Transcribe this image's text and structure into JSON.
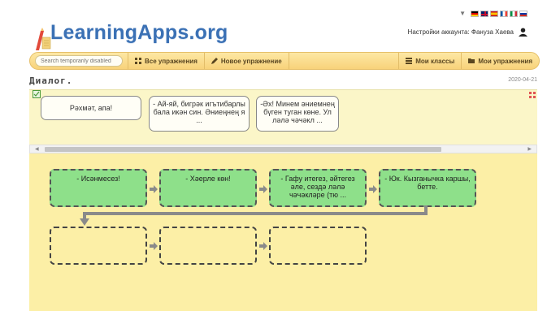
{
  "header": {
    "logo_text": "LearningApps.org",
    "account_label": "Настройки аккаунта: Фануза Хаева",
    "flags": [
      {
        "name": "de",
        "colors": [
          "#000000",
          "#dd0000",
          "#ffce00"
        ]
      },
      {
        "name": "gb",
        "colors": [
          "#012169",
          "#ffffff",
          "#c8102e"
        ]
      },
      {
        "name": "es",
        "colors": [
          "#c60b1e",
          "#ffc400",
          "#c60b1e"
        ]
      },
      {
        "name": "fr",
        "colors": [
          "#0055a4",
          "#ffffff",
          "#ef4135"
        ]
      },
      {
        "name": "it",
        "colors": [
          "#009246",
          "#ffffff",
          "#ce2b37"
        ]
      },
      {
        "name": "ru",
        "colors": [
          "#ffffff",
          "#0039a6",
          "#d52b1e"
        ]
      }
    ]
  },
  "nav": {
    "search_placeholder": "Search temporarily disabled",
    "all_exercises": "Все упражнения",
    "new_exercise": "Новое упражнение",
    "my_classes": "Мои классы",
    "my_exercises": "Мои упражнения"
  },
  "app": {
    "title": "Диалог.",
    "date": "2020-04-21"
  },
  "cards": [
    {
      "text": "Рәхмәт, апа!"
    },
    {
      "text": "- Ай-яй, бигрәк игътибарлы бала икән син. Әниеңнең я ..."
    },
    {
      "text": "-Әх! Минем әниемнең бүген туган көне. Ул ләлә чәчәкл ..."
    }
  ],
  "slots": {
    "row1": [
      {
        "text": "- Исәнмесез!"
      },
      {
        "text": "- Хәерле көн!"
      },
      {
        "text": "- Гафу итегез, әйтегез әле, сездә ләлә чәчәкләре (тю ..."
      },
      {
        "text": "- Юк. Кызганычка каршы, бетте."
      }
    ],
    "row2": [
      {
        "text": ""
      },
      {
        "text": ""
      },
      {
        "text": ""
      }
    ]
  },
  "colors": {
    "accent": "#3b71b5",
    "filled_slot": "#8ee08a",
    "board": "#fcefa6",
    "top_panel": "#fbf6c8",
    "connector": "#8a8a8a"
  }
}
